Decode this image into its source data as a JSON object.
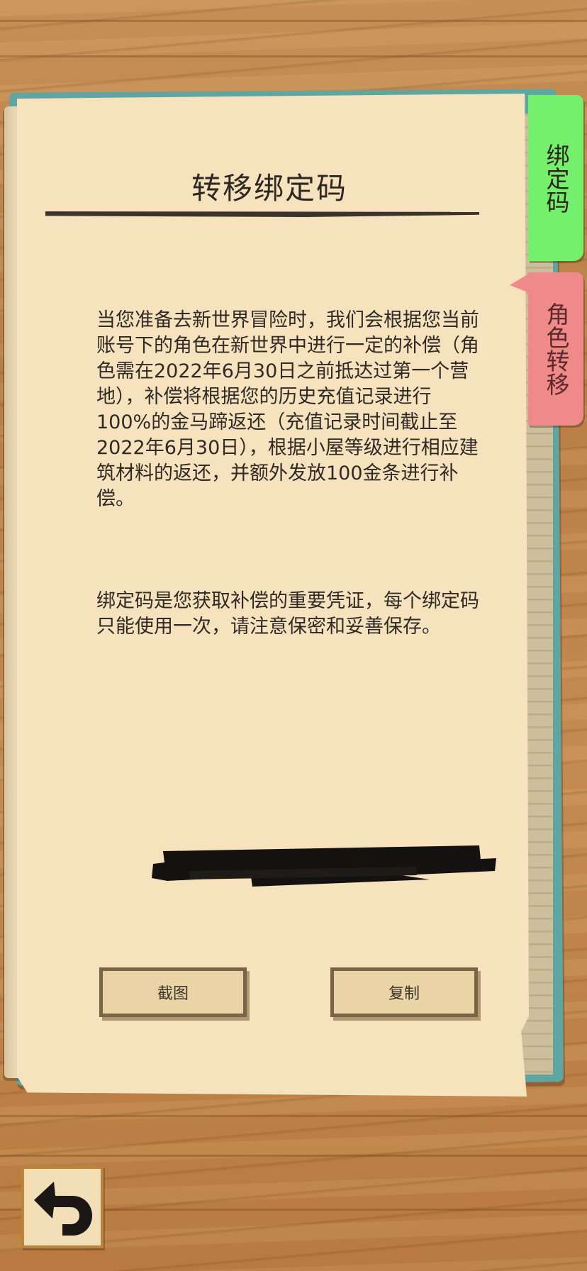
{
  "tabs": {
    "binding_code": "绑定码",
    "character_transfer": "角色转移"
  },
  "page": {
    "title": "转移绑定码",
    "paragraph1": "当您准备去新世界冒险时，我们会根据您当前账号下的角色在新世界中进行一定的补偿（角色需在2022年6月30日之前抵达过第一个营地），补偿将根据您的历史充值记录进行100%的金马蹄返还（充值记录时间截止至2022年6月30日），根据小屋等级进行相应建筑材料的返还，并额外发放100金条进行补偿。",
    "paragraph2": "绑定码是您获取补偿的重要凭证，每个绑定码只能使用一次，请注意保密和妥善保存。"
  },
  "buttons": {
    "screenshot": "截图",
    "copy": "复制"
  },
  "icons": {
    "back": "back-arrow-icon"
  },
  "colors": {
    "tab_binding": "#74f06c",
    "tab_transfer": "#f08a8a",
    "paper": "#f6e2bd",
    "cover": "#5fa6a2"
  }
}
